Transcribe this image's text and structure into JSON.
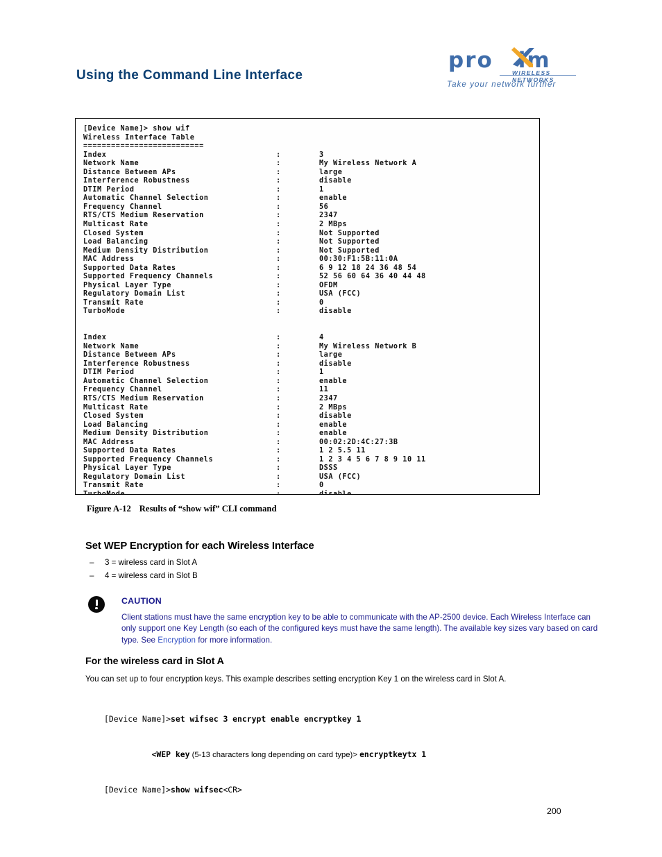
{
  "header": {
    "title": "Using the Command Line Interface",
    "logo": {
      "wordmark_left": "pro",
      "wordmark_right": "im",
      "subtitle": "WIRELESS NETWORKS",
      "tagline": "Take your network further",
      "brand_color": "#3f6daa",
      "accent_color": "#f0a72a"
    },
    "title_color": "#0c3f72"
  },
  "terminal": {
    "prompt_line": "[Device Name]> show wif",
    "table_title": "Wireless Interface Table",
    "separator": "==========================",
    "blocks": [
      {
        "rows": [
          {
            "label": "Index",
            "value": "3"
          },
          {
            "label": "Network Name",
            "value": "My Wireless Network A"
          },
          {
            "label": "Distance Between APs",
            "value": "large"
          },
          {
            "label": "Interference Robustness",
            "value": "disable"
          },
          {
            "label": "DTIM Period",
            "value": "1"
          },
          {
            "label": "Automatic Channel Selection",
            "value": "enable"
          },
          {
            "label": "Frequency Channel",
            "value": "56"
          },
          {
            "label": "RTS/CTS Medium Reservation",
            "value": "2347"
          },
          {
            "label": "Multicast Rate",
            "value": "2 MBps"
          },
          {
            "label": "Closed System",
            "value": "Not Supported"
          },
          {
            "label": "Load Balancing",
            "value": "Not Supported"
          },
          {
            "label": "Medium Density Distribution",
            "value": "Not Supported"
          },
          {
            "label": "MAC Address",
            "value": "00:30:F1:5B:11:0A"
          },
          {
            "label": "Supported Data Rates",
            "value": "6 9 12 18 24 36 48 54"
          },
          {
            "label": "Supported Frequency Channels",
            "value": "52 56 60 64 36 40 44 48"
          },
          {
            "label": "Physical Layer Type",
            "value": "OFDM"
          },
          {
            "label": "Regulatory Domain List",
            "value": "USA (FCC)"
          },
          {
            "label": "Transmit Rate",
            "value": "0"
          },
          {
            "label": "TurboMode",
            "value": "disable"
          }
        ]
      },
      {
        "rows": [
          {
            "label": "Index",
            "value": "4"
          },
          {
            "label": "Network Name",
            "value": "My Wireless Network B"
          },
          {
            "label": "Distance Between APs",
            "value": "large"
          },
          {
            "label": "Interference Robustness",
            "value": "disable"
          },
          {
            "label": "DTIM Period",
            "value": "1"
          },
          {
            "label": "Automatic Channel Selection",
            "value": "enable"
          },
          {
            "label": "Frequency Channel",
            "value": "11"
          },
          {
            "label": "RTS/CTS Medium Reservation",
            "value": "2347"
          },
          {
            "label": "Multicast Rate",
            "value": "2 MBps"
          },
          {
            "label": "Closed System",
            "value": "disable"
          },
          {
            "label": "Load Balancing",
            "value": "enable"
          },
          {
            "label": "Medium Density Distribution",
            "value": "enable"
          },
          {
            "label": "MAC Address",
            "value": "00:02:2D:4C:27:3B"
          },
          {
            "label": "Supported Data Rates",
            "value": "1 2 5.5 11"
          },
          {
            "label": "Supported Frequency Channels",
            "value": "1 2 3 4 5 6 7 8 9 10 11"
          },
          {
            "label": "Physical Layer Type",
            "value": "DSSS"
          },
          {
            "label": "Regulatory Domain List",
            "value": "USA (FCC)"
          },
          {
            "label": "Transmit Rate",
            "value": "0"
          },
          {
            "label": "TurboMode",
            "value": "disable"
          }
        ]
      }
    ]
  },
  "figure_caption": {
    "number": "Figure A-12",
    "text": "Results of “show wif” CLI command"
  },
  "section": {
    "heading": "Set WEP Encryption for each Wireless Interface",
    "bullets": [
      {
        "dash": "–",
        "text": "3 = wireless card in Slot A"
      },
      {
        "dash": "–",
        "text": "4 = wireless card in Slot B"
      }
    ]
  },
  "caution": {
    "title": "CAUTION",
    "body_part1": "Client stations must have the same encryption key to be able to communicate with the AP-2500 device. Each Wireless Interface can only support one Key Length (so each of the configured keys must have the same length). The available key sizes vary based on card type. See ",
    "link_text": "Encryption",
    "body_part2": " for more information.",
    "text_color": "#1a1a8c",
    "link_color": "#3a57c8"
  },
  "slot_a": {
    "heading": "For the wireless card in Slot A",
    "paragraph": "You can set up to four encryption keys. This example describes setting encryption Key 1 on the wireless card in Slot A.",
    "code": {
      "line1_prompt": "[Device Name]>",
      "line1_command": "set wifsec 3 encrypt enable encryptkey 1",
      "line2_indent": "          ",
      "line2_bold1": "<WEP key",
      "line2_plain": " (5-13 characters long depending on card type)> ",
      "line2_bold2": "encryptkeytx 1",
      "line3_prompt": "[Device Name]>",
      "line3_command": "show wifsec",
      "line3_suffix": "<CR>"
    }
  },
  "footer": {
    "page_number": "200"
  }
}
